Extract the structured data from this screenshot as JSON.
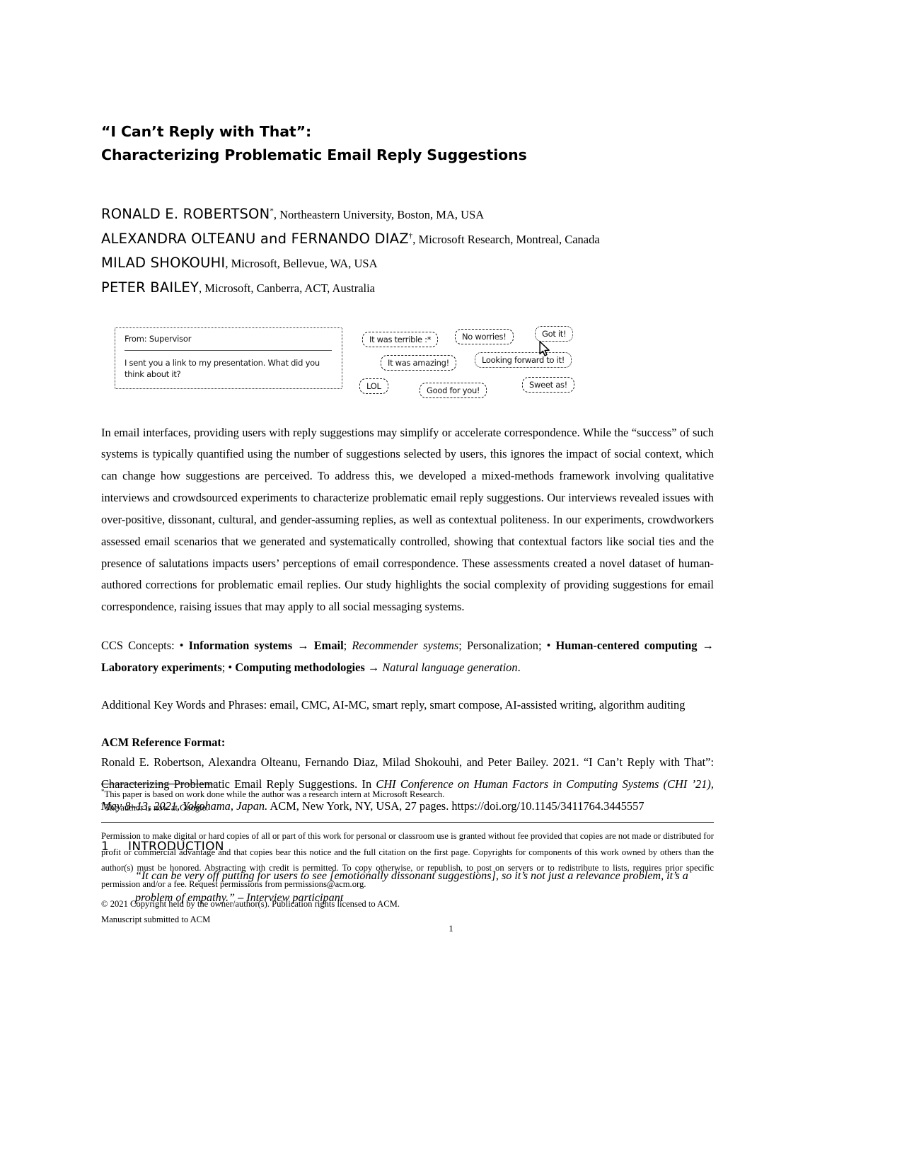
{
  "paper": {
    "title_line1": "“I Can’t Reply with That”:",
    "title_line2": "Characterizing Problematic Email Reply Suggestions",
    "authors": [
      {
        "name": "RONALD E. ROBERTSON",
        "marker": "*",
        "affiliation": ", Northeastern University, Boston, MA, USA"
      },
      {
        "name": "ALEXANDRA OLTEANU and FERNANDO DIAZ",
        "marker": "†",
        "affiliation": ", Microsoft Research, Montreal, Canada"
      },
      {
        "name": "MILAD SHOKOUHI",
        "marker": "",
        "affiliation": ", Microsoft, Bellevue, WA, USA"
      },
      {
        "name": "PETER BAILEY",
        "marker": "",
        "affiliation": ", Microsoft, Canberra, ACT, Australia"
      }
    ]
  },
  "figure": {
    "email": {
      "from_label": "From: Supervisor",
      "body": "I sent you a link to my presentation. What did you think about it?"
    },
    "suggestions": [
      "It was terrible :*",
      "No worries!",
      "Got it!",
      "It was amazing!",
      "Looking forward to it!",
      "LOL",
      "Good for you!",
      "Sweet as!"
    ],
    "cursor_icon": "mouse-pointer-icon"
  },
  "abstract": "In email interfaces, providing users with reply suggestions may simplify or accelerate correspondence. While the “success” of such systems is typically quantified using the number of suggestions selected by users, this ignores the impact of social context, which can change how suggestions are perceived. To address this, we developed a mixed-methods framework involving qualitative interviews and crowdsourced experiments to characterize problematic email reply suggestions. Our interviews revealed issues with over-positive, dissonant, cultural, and gender-assuming replies, as well as contextual politeness. In our experiments, crowdworkers assessed email scenarios that we generated and systematically controlled, showing that contextual factors like social ties and the presence of salutations impacts users’ perceptions of email correspondence. These assessments created a novel dataset of human-authored corrections for problematic email replies. Our study highlights the social complexity of providing suggestions for email correspondence, raising issues that may apply to all social messaging systems.",
  "ccs": {
    "prefix": "CCS Concepts:",
    "items": [
      {
        "bullet": "•",
        "bold": "Information systems",
        "arrow": "→",
        "bold_after": "Email",
        "semi": ";",
        "italic": "Recommender systems",
        "tail": "; Personalization;"
      },
      {
        "bullet": "•",
        "bold": "Human-centered computing",
        "arrow": "→",
        "bold_after": "Laboratory experiments",
        "tail": ";"
      },
      {
        "bullet": "•",
        "bold": "Computing methodologies",
        "arrow": "→",
        "italic": "Natural language generation",
        "tail": "."
      }
    ]
  },
  "keywords": "Additional Key Words and Phrases: email, CMC, AI-MC, smart reply, smart compose, AI-assisted writing, algorithm auditing",
  "reference": {
    "heading": "ACM Reference Format:",
    "part1": "Ronald E. Robertson, Alexandra Olteanu, Fernando Diaz, Milad Shokouhi, and Peter Bailey. 2021. “I Can’t Reply with That”: Characterizing Problematic Email Reply Suggestions. In ",
    "italic1": "CHI Conference on Human Factors in Computing Systems (CHI ’21), May 8–13, 2021, Yokohama, Japan.",
    "part2": " ACM, New York, NY, USA, 27 pages. https://doi.org/10.1145/3411764.3445557"
  },
  "section": {
    "number": "1",
    "title": "INTRODUCTION",
    "quote": "“It can be very off putting for users to see [emotionally dissonant suggestions], so it’s not just a relevance problem, it’s a problem of empathy.” – Interview participant"
  },
  "footnotes": [
    {
      "marker": "*",
      "text": "This paper is based on work done while the author was a research intern at Microsoft Research."
    },
    {
      "marker": "†",
      "text": "The author is now at Google."
    }
  ],
  "permission": {
    "body": "Permission to make digital or hard copies of all or part of this work for personal or classroom use is granted without fee provided that copies are not made or distributed for profit or commercial advantage and that copies bear this notice and the full citation on the first page. Copyrights for components of this work owned by others than the author(s) must be honored. Abstracting with credit is permitted. To copy otherwise, or republish, to post on servers or to redistribute to lists, requires prior specific permission and/or a fee. Request permissions from permissions@acm.org.",
    "copyright": "© 2021 Copyright held by the owner/author(s). Publication rights licensed to ACM.",
    "manuscript": "Manuscript submitted to ACM"
  },
  "page_number": "1"
}
